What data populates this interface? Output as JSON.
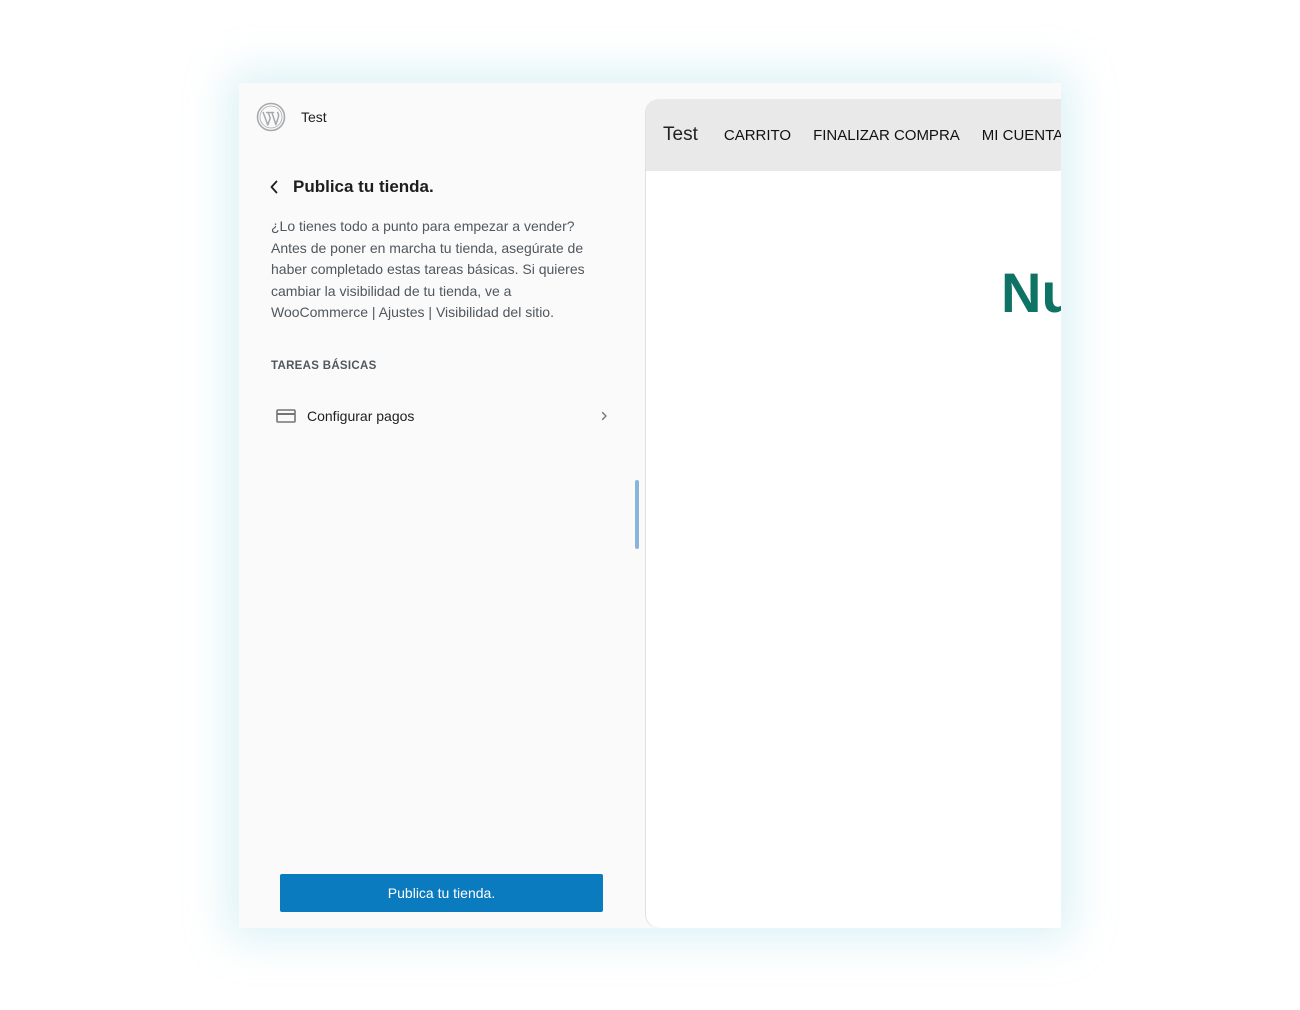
{
  "sidebar": {
    "site_name": "Test",
    "panel_title": "Publica tu tienda.",
    "description": "¿Lo tienes todo a punto para empezar a vender? Antes de poner en marcha tu tienda, asegúrate de haber completado estas tareas básicas. Si quieres cambiar la visibilidad de tu tienda, ve a WooCommerce | Ajustes | Visibilidad del sitio.",
    "section_title": "TAREAS BÁSICAS",
    "tasks": [
      {
        "label": "Configurar pagos",
        "icon": "card-icon"
      }
    ],
    "publish_button": "Publica tu tienda."
  },
  "preview": {
    "site_title": "Test",
    "nav": [
      "CARRITO",
      "FINALIZAR COMPRA",
      "MI CUENTA"
    ],
    "heading": "Nu"
  },
  "colors": {
    "accent": "#0a7bbf",
    "heading": "#0e7364",
    "nav_bg": "#e9e9e9",
    "sidebar_bg": "#fafafa"
  }
}
